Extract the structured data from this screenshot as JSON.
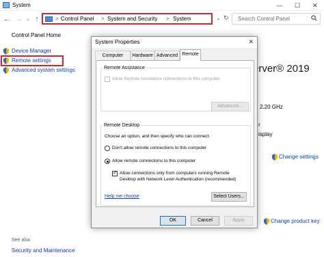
{
  "window": {
    "title": "System",
    "controls": {
      "minimize": "—",
      "maximize": "☐",
      "close": "✕"
    }
  },
  "nav": {
    "back": "←",
    "forward": "→",
    "up": "↑",
    "dropdown": "⌄",
    "refresh": "↻"
  },
  "address": {
    "crumbs": [
      "Control Panel",
      "System and Security",
      "System"
    ],
    "separator": ">"
  },
  "search": {
    "placeholder": "Search Control Panel",
    "icon": "search-icon"
  },
  "left_panel": {
    "home": "Control Panel Home",
    "items": [
      {
        "label": "Device Manager",
        "icon": "shield-icon"
      },
      {
        "label": "Remote settings",
        "icon": "shield-icon"
      },
      {
        "label": "Advanced system settings",
        "icon": "shield-icon"
      }
    ],
    "see_also": "See also",
    "see_also_items": [
      "Security and Maintenance"
    ]
  },
  "background": {
    "product_fragment": "erver® 2019",
    "cpu_fragment": "2.20 GHz",
    "arch_fragment": "r",
    "display_fragment": "isplay",
    "change_settings": "Change settings",
    "change_product_key": "Change product key"
  },
  "dialog": {
    "title": "System Properties",
    "close": "✕",
    "tabs": [
      "Computer Name",
      "Hardware",
      "Advanced",
      "Remote"
    ],
    "active_tab": "Remote",
    "remote_assistance": {
      "group": "Remote Assistance",
      "checkbox": "Allow Remote Assistance connections to this computer",
      "checked": false,
      "advanced_button": "Advanced..."
    },
    "remote_desktop": {
      "group": "Remote Desktop",
      "intro": "Choose an option, and then specify who can connect.",
      "option_dont_allow": "Don't allow remote connections to this computer",
      "option_allow": "Allow remote connections to this computer",
      "selected": "allow",
      "nla_line1": "Allow connections only from computers running Remote",
      "nla_line2": "Desktop with Network Level Authentication (recommended)",
      "nla_checked": true,
      "help_link": "Help me choose",
      "select_users_button": "Select Users..."
    },
    "buttons": {
      "ok": "OK",
      "cancel": "Cancel",
      "apply": "Apply"
    }
  },
  "colors": {
    "highlight_border": "#d0252b",
    "link": "#0b3ea9"
  }
}
